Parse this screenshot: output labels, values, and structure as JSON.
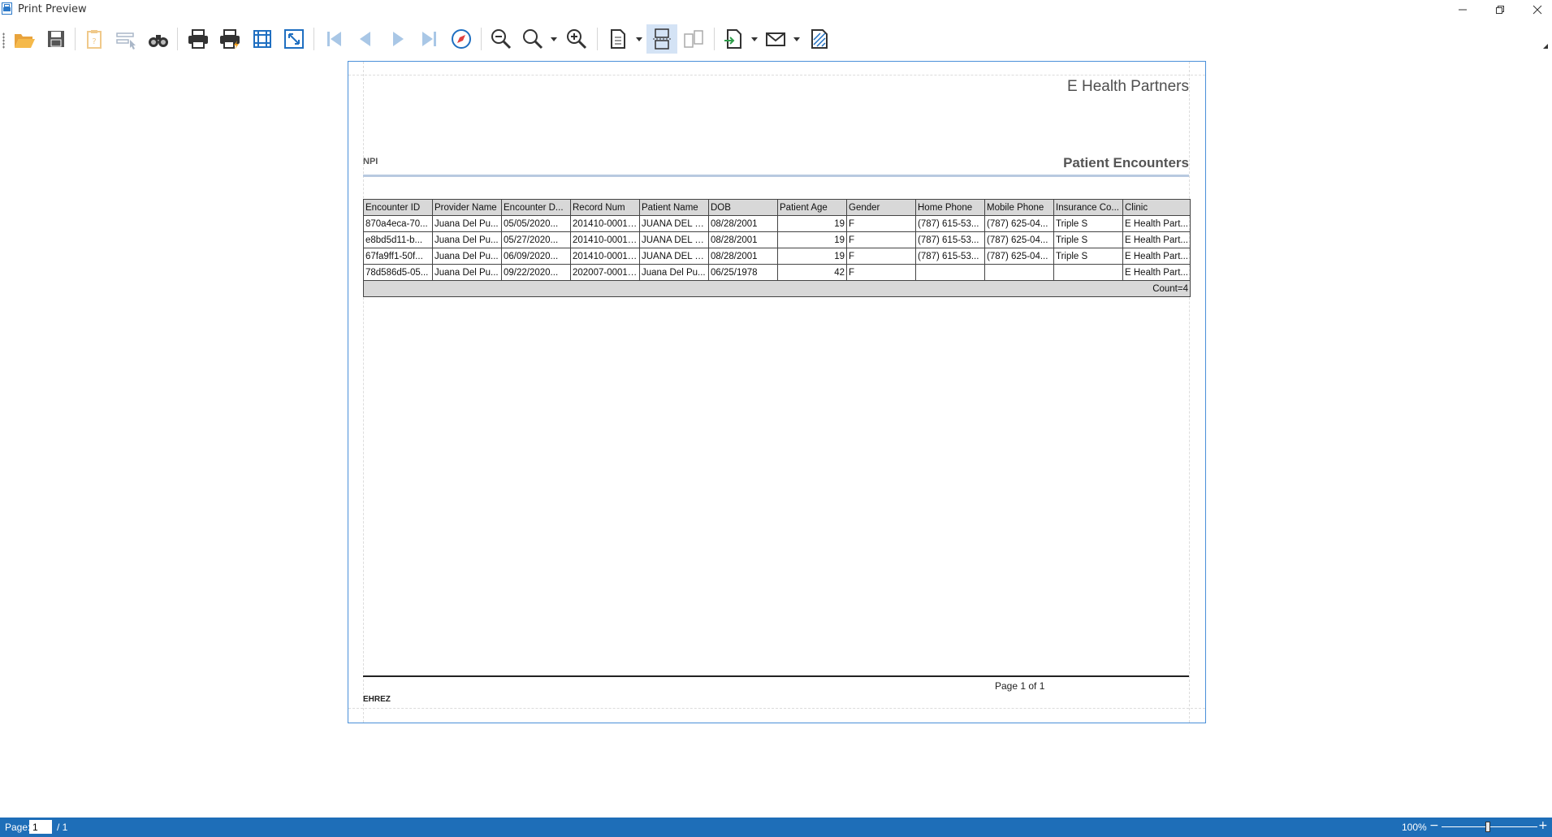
{
  "window": {
    "title": "Print Preview"
  },
  "toolbar": {
    "buttons": [
      "open-icon",
      "save-icon",
      "parameters-icon",
      "editing-fields-icon",
      "find-icon",
      "print-icon",
      "quick-print-icon",
      "page-setup-icon",
      "scale-icon",
      "first-page-icon",
      "previous-page-icon",
      "next-page-icon",
      "last-page-icon",
      "navigation-icon",
      "zoom-out-icon",
      "zoom-icon",
      "zoom-in-icon",
      "multiple-pages-icon",
      "continuous-scrolling-icon",
      "side-by-side-icon",
      "export-icon",
      "send-email-icon",
      "watermark-icon"
    ]
  },
  "report": {
    "company": "E Health Partners",
    "npi_label": "NPI",
    "title": "Patient Encounters",
    "columns": [
      "Encounter ID",
      "Provider Name",
      "Encounter D...",
      "Record Num",
      "Patient Name",
      "DOB",
      "Patient Age",
      "Gender",
      "Home Phone",
      "Mobile Phone",
      "Insurance Co...",
      "Clinic"
    ],
    "rows": [
      [
        "870a4eca-70...",
        "Juana Del Pu...",
        "05/05/2020...",
        "201410-0001 ...",
        "JUANA DEL P...",
        "08/28/2001",
        "19",
        "F",
        "(787) 615-53...",
        "(787) 625-04...",
        "Triple S",
        "E Health Part..."
      ],
      [
        "e8bd5d11-b...",
        "Juana Del Pu...",
        "05/27/2020...",
        "201410-0001 ...",
        "JUANA DEL P...",
        "08/28/2001",
        "19",
        "F",
        "(787) 615-53...",
        "(787) 625-04...",
        "Triple S",
        "E Health Part..."
      ],
      [
        "67fa9ff1-50f...",
        "Juana Del Pu...",
        "06/09/2020...",
        "201410-0001 ...",
        "JUANA DEL P...",
        "08/28/2001",
        "19",
        "F",
        "(787) 615-53...",
        "(787) 625-04...",
        "Triple S",
        "E Health Part..."
      ],
      [
        "78d586d5-05...",
        "Juana Del Pu...",
        "09/22/2020...",
        "202007-0001 ...",
        "Juana  Del Pu...",
        "06/25/1978",
        "42",
        "F",
        "",
        "",
        "",
        "E Health Part..."
      ]
    ],
    "total": "Count=4",
    "page_footer": "Page 1 of 1",
    "user": "EHREZ"
  },
  "status": {
    "page_label": "Page:",
    "page_value": "1",
    "page_total": "/ 1",
    "zoom": "100%",
    "zoom_level_percent": 100
  },
  "colors": {
    "statusbar": "#1e6eb8",
    "page_border": "#4a90d9",
    "header_fill": "#d8d8d8"
  }
}
